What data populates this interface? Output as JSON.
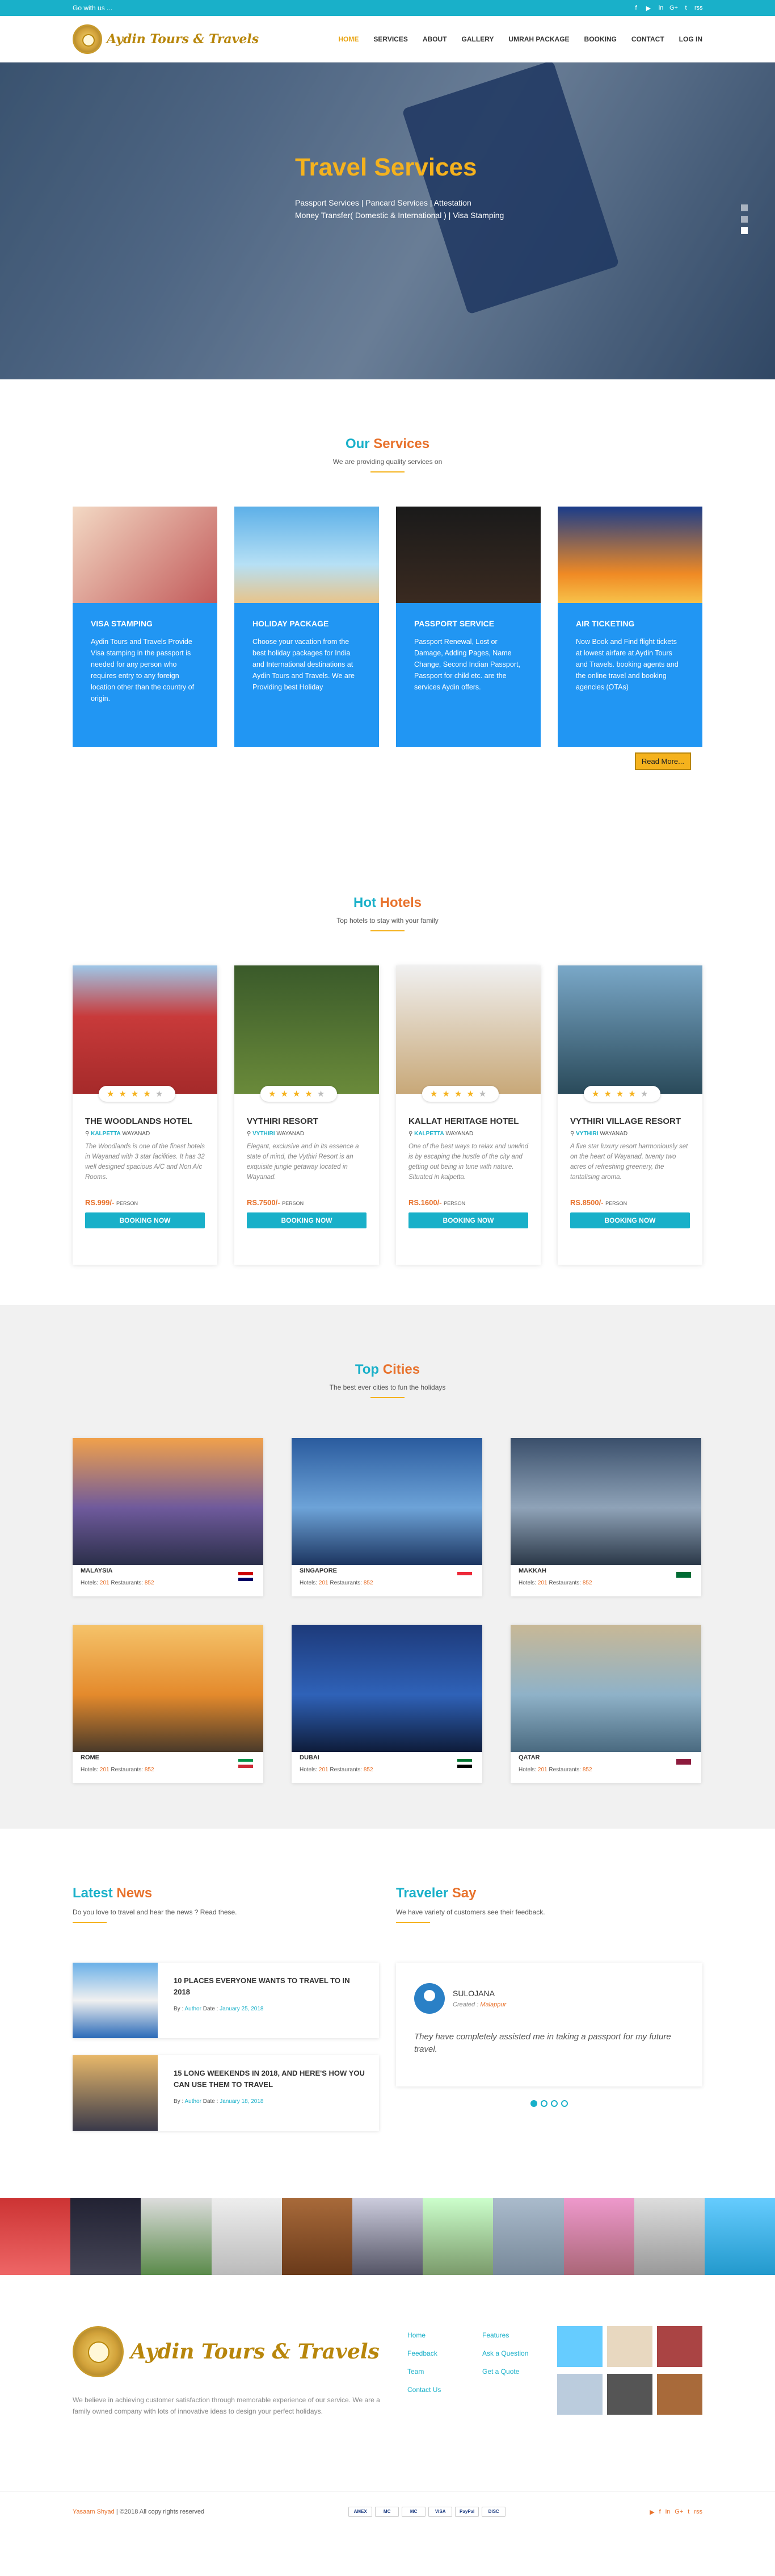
{
  "topbar": {
    "text": "Go with us ...",
    "social": [
      "f",
      "▶",
      "in",
      "G+",
      "t",
      "rss"
    ]
  },
  "brand": {
    "name": "Aydin Tours & Travels"
  },
  "menu": [
    "HOME",
    "SERVICES",
    "ABOUT",
    "GALLERY",
    "UMRAH PACKAGE",
    "BOOKING",
    "CONTACT",
    "LOG IN"
  ],
  "hero": {
    "title": "Travel Services",
    "line1": "Passport Services | Pancard Services | Attestation",
    "line2": "Money Transfer( Domestic & International ) | Visa Stamping"
  },
  "services": {
    "title_a": "Our",
    "title_b": "Services",
    "subtitle": "We are providing quality services on",
    "items": [
      {
        "name": "VISA STAMPING",
        "desc": "Aydin Tours and Travels Provide Visa stamping in the passport is needed for any person who requires entry to any foreign location other than the country of origin."
      },
      {
        "name": "HOLIDAY PACKAGE",
        "desc": "Choose your vacation from the best holiday packages for India and International destinations at Aydin Tours and Travels. We are Providing best Holiday"
      },
      {
        "name": "PASSPORT SERVICE",
        "desc": "Passport Renewal, Lost or Damage, Adding Pages, Name Change, Second Indian Passport, Passport for child etc. are the services Aydin offers."
      },
      {
        "name": "AIR TICKETING",
        "desc": "Now Book and Find flight tickets at lowest airfare at Aydin Tours and Travels. booking agents and the online travel and booking agencies (OTAs)"
      }
    ],
    "read_more": "Read More..."
  },
  "hotels": {
    "title_a": "Hot",
    "title_b": "Hotels",
    "subtitle": "Top hotels to stay with your family",
    "items": [
      {
        "name": "THE WOODLANDS HOTEL",
        "loc": "KALPETTA",
        "region": "WAYANAD",
        "desc": "The Woodlands is one of the finest hotels in Wayanad with 3 star facilities. It has 32 well designed spacious A/C and Non A/c Rooms.",
        "price": "RS.999/-",
        "per": "PERSON",
        "rating": 4
      },
      {
        "name": "VYTHIRI RESORT",
        "loc": "VYTHIRI",
        "region": "WAYANAD",
        "desc": "Elegant, exclusive and in its essence a state of mind, the Vythiri Resort is an exquisite jungle getaway located in Wayanad.",
        "price": "RS.7500/-",
        "per": "PERSON",
        "rating": 4
      },
      {
        "name": "KALLAT HERITAGE HOTEL",
        "loc": "KALPETTA",
        "region": "WAYANAD",
        "desc": "One of the best ways to relax and unwind is by escaping the hustle of the city and getting out being in tune with nature. Situated in kalpetta.",
        "price": "RS.1600/-",
        "per": "PERSON",
        "rating": 4
      },
      {
        "name": "VYTHIRI VILLAGE RESORT",
        "loc": "VYTHIRI",
        "region": "WAYANAD",
        "desc": "A five star luxury resort harmoniously set on the heart of Wayanad, twenty two acres of refreshing greenery, the tantalising aroma.",
        "price": "RS.8500/-",
        "per": "PERSON",
        "rating": 4
      }
    ],
    "book": "BOOKING NOW"
  },
  "cities": {
    "title_a": "Top",
    "title_b": "Cities",
    "subtitle": "The best ever cities to fun the holidays",
    "hotels_label": "Hotels:",
    "restaurants_label": "Restaurants:",
    "items": [
      {
        "name": "MALAYSIA",
        "hotels": "201",
        "rest": "852",
        "flag": [
          "#cc0001",
          "#ffffff",
          "#010066"
        ],
        "img": [
          "#f1a14b",
          "#6f5a9c",
          "#2b2f4a"
        ]
      },
      {
        "name": "SINGAPORE",
        "hotels": "201",
        "rest": "852",
        "flag": [
          "#ed2939",
          "#ffffff",
          "#ffffff"
        ],
        "img": [
          "#2a5b9e",
          "#6da3d8",
          "#1c3560"
        ]
      },
      {
        "name": "MAKKAH",
        "hotels": "201",
        "rest": "852",
        "flag": [
          "#006c35",
          "#006c35",
          "#ffffff"
        ],
        "img": [
          "#3a4f6b",
          "#8fa3b8",
          "#2b3848"
        ]
      },
      {
        "name": "ROME",
        "hotels": "201",
        "rest": "852",
        "flag": [
          "#009246",
          "#ffffff",
          "#ce2b37"
        ],
        "img": [
          "#f5c36a",
          "#e48a2c",
          "#4a3a2a"
        ]
      },
      {
        "name": "DUBAI",
        "hotels": "201",
        "rest": "852",
        "flag": [
          "#00732f",
          "#ffffff",
          "#000000"
        ],
        "img": [
          "#1d3a7a",
          "#2f62b8",
          "#0e1c3a"
        ]
      },
      {
        "name": "QATAR",
        "hotels": "201",
        "rest": "852",
        "flag": [
          "#8d1b3d",
          "#8d1b3d",
          "#ffffff"
        ],
        "img": [
          "#c8b896",
          "#8fb2c8",
          "#4a6a80"
        ]
      }
    ]
  },
  "news": {
    "title_a": "Latest",
    "title_b": "News",
    "subtitle": "Do you love to travel and hear the news ? Read these.",
    "items": [
      {
        "title": "10 PLACES EVERYONE WANTS TO TRAVEL TO IN 2018",
        "by": "By :",
        "author": "Author",
        "date_label": "Date :",
        "date": "January 25, 2018"
      },
      {
        "title": "15 LONG WEEKENDS IN 2018, AND HERE'S HOW YOU CAN USE THEM TO TRAVEL",
        "by": "By :",
        "author": "Author",
        "date_label": "Date :",
        "date": "January 18, 2018"
      }
    ]
  },
  "say": {
    "title_a": "Traveler",
    "title_b": "Say",
    "subtitle": "We have variety of customers see their feedback.",
    "name": "SULOJANA",
    "role_label": "Created :",
    "role": "Malappur",
    "text": "They have completely assisted me in taking a passport for my future travel."
  },
  "footer": {
    "desc": "We believe in achieving customer satisfaction through memorable experience of our service. We are a family owned company with lots of innovative ideas to design your perfect holidays.",
    "links1": [
      "Home",
      "Feedback",
      "Team",
      "Contact Us"
    ],
    "links2": [
      "Features",
      "Ask a Question",
      "Get a Quote"
    ],
    "credit": "Yasaam Shyad",
    "copy": "| ©2018 All copy rights reserved",
    "pays": [
      "AMEX",
      "MC",
      "MC",
      "VISA",
      "PayPal",
      "DISC"
    ]
  },
  "colors": {
    "primary": "#19b0c9",
    "accent": "#e8722c",
    "gold": "#f5b21d",
    "service": "#2196f3"
  }
}
